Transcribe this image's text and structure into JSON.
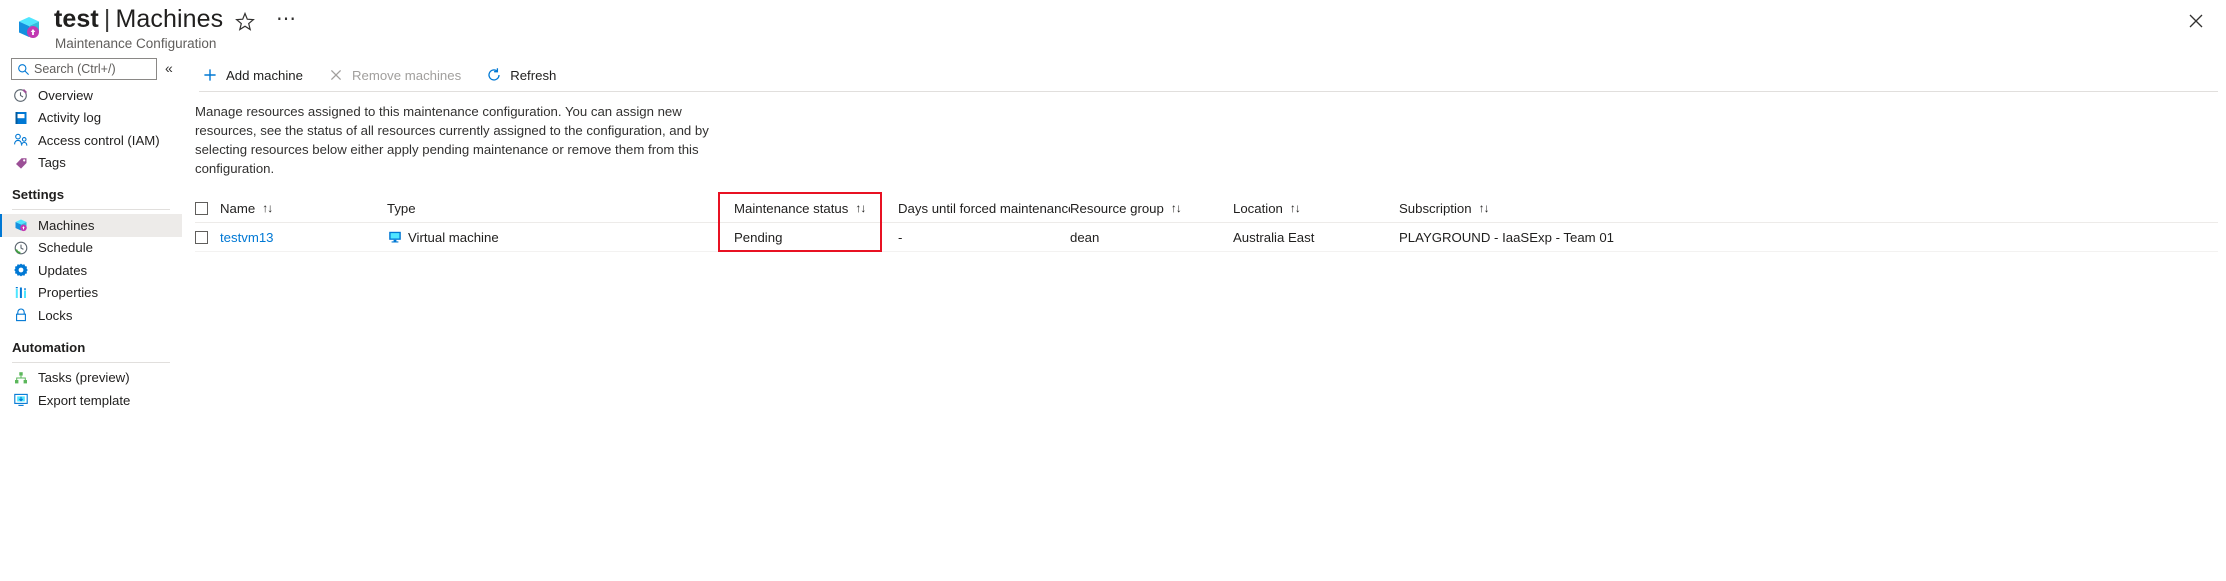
{
  "header": {
    "resource_name": "test",
    "separator": "|",
    "page_name": "Machines",
    "subtitle": "Maintenance Configuration",
    "favorite_icon": "star-icon",
    "more_icon": "ellipsis-icon",
    "close_icon": "close-icon",
    "resource_icon": "maintenance-configuration-icon"
  },
  "sidebar": {
    "search": {
      "placeholder": "Search (Ctrl+/)",
      "value": "",
      "icon": "search-icon"
    },
    "collapse_label": "«",
    "items": [
      {
        "label": "Overview",
        "icon": "overview-icon",
        "selected": false
      },
      {
        "label": "Activity log",
        "icon": "activity-log-icon",
        "selected": false
      },
      {
        "label": "Access control (IAM)",
        "icon": "access-control-icon",
        "selected": false
      },
      {
        "label": "Tags",
        "icon": "tags-icon",
        "selected": false
      }
    ],
    "groups": [
      {
        "title": "Settings",
        "items": [
          {
            "label": "Machines",
            "icon": "machines-icon",
            "selected": true
          },
          {
            "label": "Schedule",
            "icon": "schedule-icon",
            "selected": false
          },
          {
            "label": "Updates",
            "icon": "updates-icon",
            "selected": false
          },
          {
            "label": "Properties",
            "icon": "properties-icon",
            "selected": false
          },
          {
            "label": "Locks",
            "icon": "locks-icon",
            "selected": false
          }
        ]
      },
      {
        "title": "Automation",
        "items": [
          {
            "label": "Tasks (preview)",
            "icon": "tasks-icon",
            "selected": false
          },
          {
            "label": "Export template",
            "icon": "export-template-icon",
            "selected": false
          }
        ]
      }
    ]
  },
  "toolbar": {
    "add_machine": {
      "label": "Add machine",
      "icon": "plus-icon",
      "disabled": false
    },
    "remove_machines": {
      "label": "Remove machines",
      "icon": "cross-icon",
      "disabled": true
    },
    "refresh": {
      "label": "Refresh",
      "icon": "refresh-icon",
      "disabled": false
    }
  },
  "description": "Manage resources assigned to this maintenance configuration. You can assign new resources, see the status of all resources currently assigned to the configuration, and by selecting resources below either apply pending maintenance or remove them from this configuration.",
  "table": {
    "sort_glyph": "↑↓",
    "columns": [
      {
        "key": "name",
        "label": "Name",
        "sortable": true
      },
      {
        "key": "type",
        "label": "Type",
        "sortable": false
      },
      {
        "key": "maintenance_status",
        "label": "Maintenance status",
        "sortable": true
      },
      {
        "key": "days_until_forced",
        "label": "Days until forced maintenance",
        "sortable": true
      },
      {
        "key": "resource_group",
        "label": "Resource group",
        "sortable": true
      },
      {
        "key": "location",
        "label": "Location",
        "sortable": true
      },
      {
        "key": "subscription",
        "label": "Subscription",
        "sortable": true
      }
    ],
    "rows": [
      {
        "name": "testvm13",
        "type": "Virtual machine",
        "type_icon": "virtual-machine-icon",
        "maintenance_status": "Pending",
        "days_until_forced": "-",
        "resource_group": "dean",
        "location": "Australia East",
        "subscription": "PLAYGROUND - IaaSExp - Team 01",
        "selected": false
      }
    ]
  },
  "annotation": {
    "color": "#e81123",
    "target": "maintenance-status-column"
  }
}
